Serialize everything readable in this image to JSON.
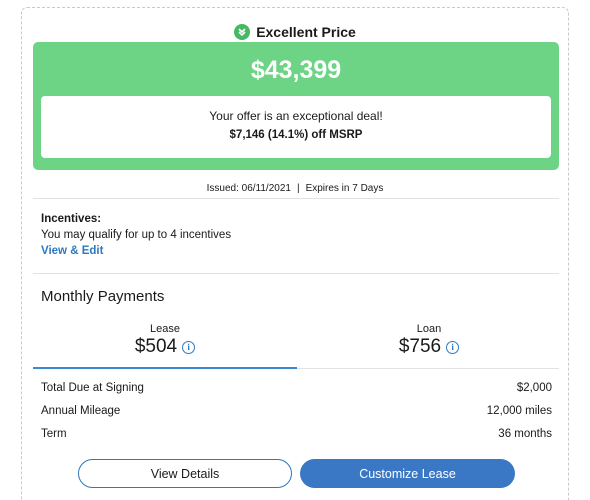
{
  "rating": {
    "label": "Excellent Price",
    "icon": "double-chevron-down-icon",
    "color": "#45b864"
  },
  "price": {
    "value": "$43,399",
    "box_color": "#6dd485"
  },
  "offer": {
    "headline": "Your offer is an exceptional deal!",
    "savings": "$7,146 (14.1%) off MSRP"
  },
  "issued": {
    "issued_text": "Issued: 06/11/2021",
    "separator": "|",
    "expires_text": "Expires in 7 Days"
  },
  "incentives": {
    "title": "Incentives:",
    "description": "You may qualify for up to 4 incentives",
    "link_label": "View & Edit"
  },
  "monthly": {
    "title": "Monthly Payments",
    "tabs": [
      {
        "label": "Lease",
        "amount": "$504",
        "selected": true
      },
      {
        "label": "Loan",
        "amount": "$756",
        "selected": false
      }
    ],
    "info_icon": "info-icon"
  },
  "details": [
    {
      "label": "Total Due at Signing",
      "value": "$2,000"
    },
    {
      "label": "Annual Mileage",
      "value": "12,000 miles"
    },
    {
      "label": "Term",
      "value": "36 months"
    }
  ],
  "buttons": {
    "view_details": "View Details",
    "customize": "Customize Lease"
  },
  "colors": {
    "accent_blue": "#2b79c2",
    "primary_button": "#3a78c5"
  }
}
